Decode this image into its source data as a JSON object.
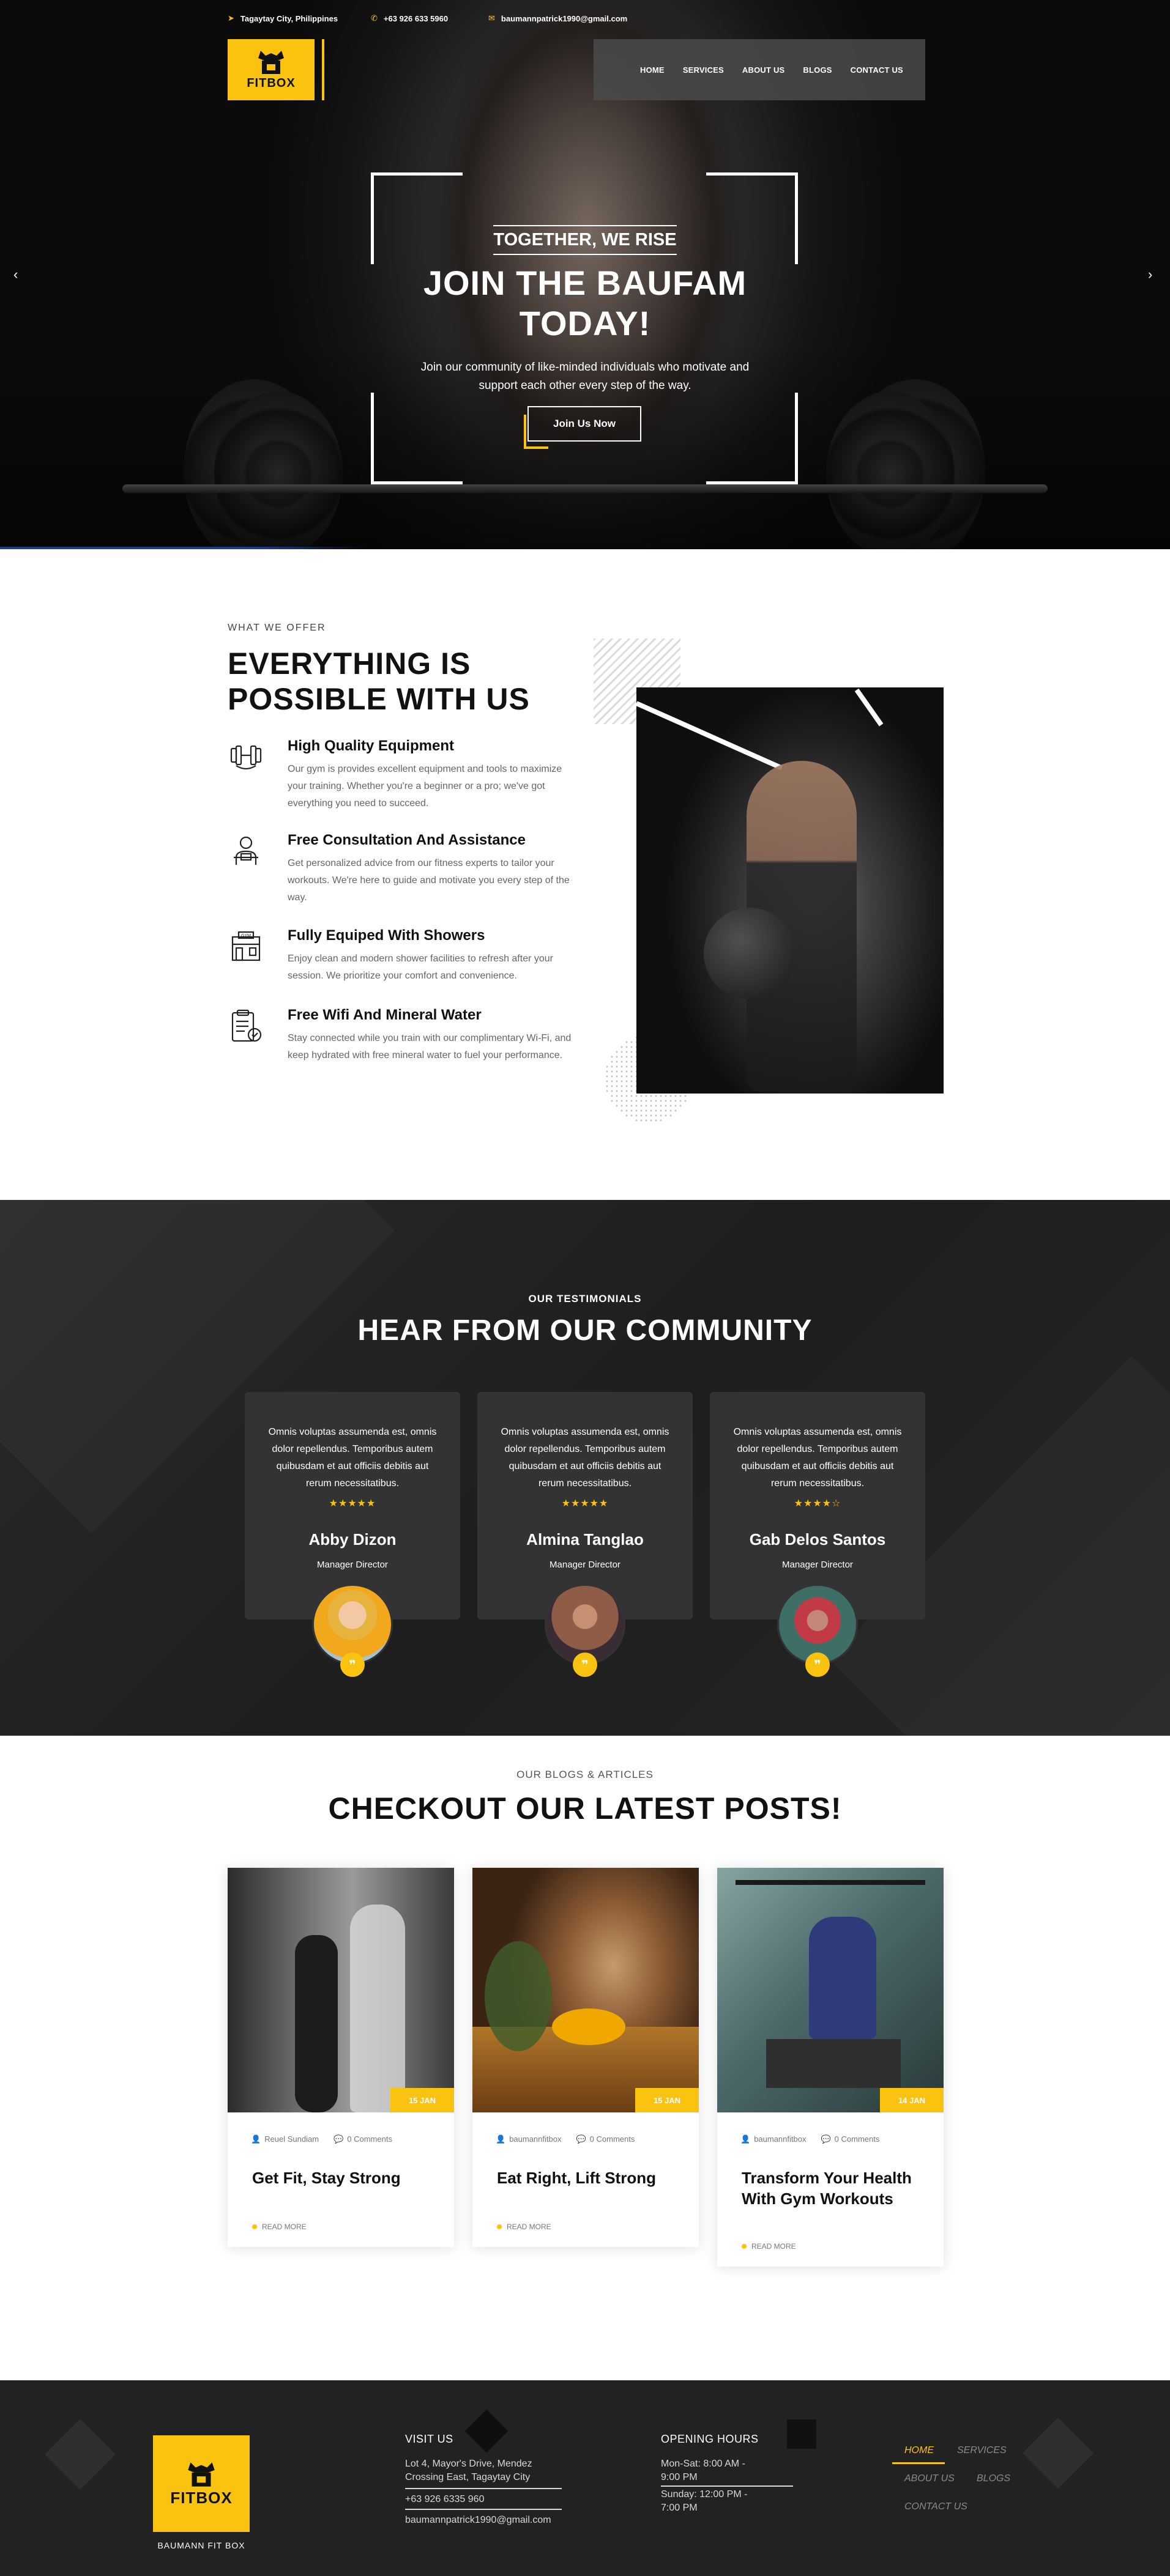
{
  "brand": {
    "name": "FITBOX",
    "footer_name": "BAUMANN FIT BOX",
    "accent": "#f9c310"
  },
  "topbar": {
    "location": "Tagaytay City, Philippines",
    "phone": "+63 926 633 5960",
    "email": "baumannpatrick1990@gmail.com"
  },
  "nav": {
    "items": [
      "HOME",
      "SERVICES",
      "ABOUT US",
      "BLOGS",
      "CONTACT US"
    ]
  },
  "hero": {
    "kicker": "TOGETHER, WE RISE",
    "title": "JOIN THE BAUFAM TODAY!",
    "subtitle": "Join our community of like-minded individuals who motivate and support each other every step of the way.",
    "cta": "Join Us Now",
    "prev": "‹",
    "next": "›"
  },
  "services": {
    "kicker": "WHAT WE OFFER",
    "title": "EVERYTHING IS POSSIBLE WITH US",
    "items": [
      {
        "title": "High Quality Equipment",
        "desc": "Our gym is provides excellent equipment and tools to maximize your training. Whether you're a beginner or a pro; we've got everything you need to succeed.",
        "icon": "dumbbell-icon"
      },
      {
        "title": "Free Consultation And Assistance",
        "desc": "Get personalized advice from our fitness experts to tailor your workouts. We're here to guide and motivate you every step of the way.",
        "icon": "trainer-icon"
      },
      {
        "title": "Fully Equiped With Showers",
        "desc": "Enjoy clean and modern shower facilities to refresh after your session. We prioritize your comfort and convenience.",
        "icon": "gym-building-icon"
      },
      {
        "title": "Free Wifi And Mineral Water",
        "desc": "Stay connected while you train with our complimentary Wi-Fi, and keep hydrated with free mineral water to fuel your performance.",
        "icon": "clipboard-icon"
      }
    ]
  },
  "testimonials": {
    "kicker": "OUR TESTIMONIALS",
    "title": "HEAR FROM OUR COMMUNITY",
    "items": [
      {
        "quote": "Omnis voluptas assumenda est, omnis dolor repellendus. Temporibus autem quibusdam et aut officiis debitis aut rerum necessitatibus.",
        "stars": "★★★★★",
        "rating": 5,
        "name": "Abby Dizon",
        "role": "Manager Director"
      },
      {
        "quote": "Omnis voluptas assumenda est, omnis dolor repellendus. Temporibus autem quibusdam et aut officiis debitis aut rerum necessitatibus.",
        "stars": "★★★★★",
        "rating": 5,
        "name": "Almina Tanglao",
        "role": "Manager Director"
      },
      {
        "quote": "Omnis voluptas assumenda est, omnis dolor repellendus. Temporibus autem quibusdam et aut officiis debitis aut rerum necessitatibus.",
        "stars": "★★★★☆",
        "rating": 4,
        "name": "Gab Delos Santos",
        "role": "Manager Director"
      }
    ],
    "quote_mark": "❞"
  },
  "blogs": {
    "kicker": "OUR BLOGS & ARTICLES",
    "title": "CHECKOUT OUR LATEST POSTS!",
    "read_more": "READ MORE",
    "posts": [
      {
        "date": "15 JAN",
        "author": "Reuel Sundiam",
        "comments": "0 Comments",
        "title": "Get Fit, Stay Strong"
      },
      {
        "date": "15 JAN",
        "author": "baumannfitbox",
        "comments": "0 Comments",
        "title": "Eat Right, Lift Strong"
      },
      {
        "date": "14 JAN",
        "author": "baumannfitbox",
        "comments": "0 Comments",
        "title": "Transform Your Health With Gym Workouts"
      }
    ]
  },
  "footer": {
    "visit_heading": "VISIT US",
    "address": "Lot 4, Mayor's Drive, Mendez Crossing East, Tagaytay City",
    "phone": "+63 926 6335 960",
    "email": "baumannpatrick1990@gmail.com",
    "hours_heading": "OPENING HOURS",
    "hours_weekday": "Mon-Sat: 8:00 AM - 9:00 PM",
    "hours_sunday": "Sunday: 12:00 PM - 7:00 PM",
    "nav": [
      "HOME",
      "SERVICES",
      "ABOUT US",
      "BLOGS",
      "CONTACT US"
    ]
  }
}
